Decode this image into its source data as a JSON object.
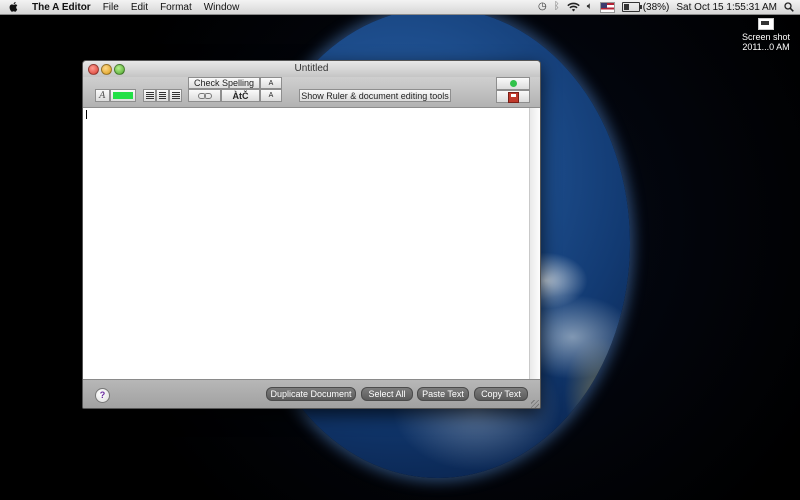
{
  "menubar": {
    "app_name": "The A Editor",
    "menus": [
      "File",
      "Edit",
      "Format",
      "Window"
    ],
    "battery": "(38%)",
    "clock": "Sat Oct 15  1:55:31 AM"
  },
  "desktop": {
    "screenshot_label_line1": "Screen shot",
    "screenshot_label_line2": "2011...0 AM"
  },
  "window": {
    "title": "Untitled",
    "toolbar": {
      "font_glyph": "A",
      "color": "#22e046",
      "check_spelling": "Check Spelling",
      "aa_small": "A",
      "special_chars": "ÀtČ",
      "ruler_toggle": "Show Ruler & document editing tools"
    },
    "editor": {
      "content": ""
    },
    "footer": {
      "help": "?",
      "duplicate": "Duplicate Document",
      "select_all": "Select All",
      "paste": "Paste Text",
      "copy": "Copy Text"
    }
  }
}
